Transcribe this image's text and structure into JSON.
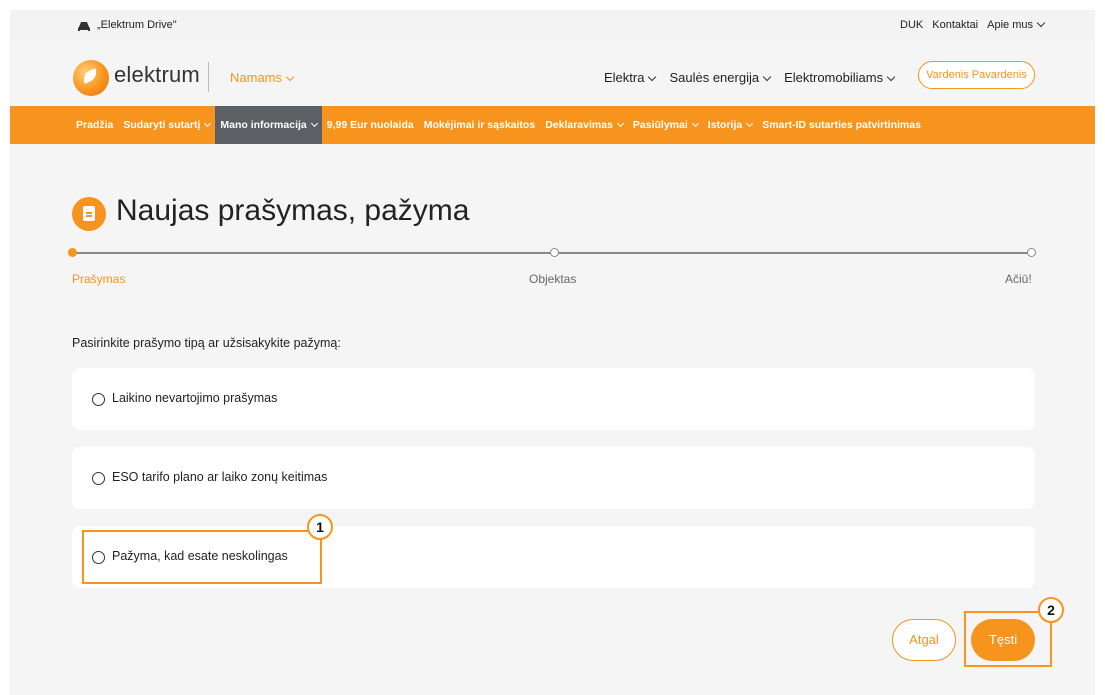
{
  "topbar": {
    "drive_label": "„Elektrum Drive\"",
    "links": [
      "DUK",
      "Kontaktai",
      "Apie mus"
    ]
  },
  "header": {
    "logo_text": "elektrum",
    "segment": "Namams",
    "nav": [
      "Elektra",
      "Saulės energija",
      "Elektromobiliams"
    ],
    "user_button": "Vardenis Pavardenis"
  },
  "orange_nav": {
    "items": [
      {
        "label": "Pradžia",
        "dropdown": false,
        "active": false
      },
      {
        "label": "Sudaryti sutartį",
        "dropdown": true,
        "active": false
      },
      {
        "label": "Mano informacija",
        "dropdown": true,
        "active": true
      },
      {
        "label": "9,99 Eur nuolaida",
        "dropdown": false,
        "active": false
      },
      {
        "label": "Mokėjimai ir sąskaitos",
        "dropdown": false,
        "active": false
      },
      {
        "label": "Deklaravimas",
        "dropdown": true,
        "active": false
      },
      {
        "label": "Pasiūlymai",
        "dropdown": true,
        "active": false
      },
      {
        "label": "Istorija",
        "dropdown": true,
        "active": false
      },
      {
        "label": "Smart-ID sutarties patvirtinimas",
        "dropdown": false,
        "active": false
      }
    ]
  },
  "page": {
    "title": "Naujas prašymas, pažyma",
    "steps": [
      "Prašymas",
      "Objektas",
      "Ačiū!"
    ],
    "current_step": 1,
    "question": "Pasirinkite prašymo tipą ar užsisakykite pažymą:",
    "options": [
      "Laikino nevartojimo prašymas",
      "ESO tarifo plano ar laiko zonų keitimas",
      "Pažyma, kad esate neskolingas"
    ],
    "back_button": "Atgal",
    "next_button": "Tęsti"
  },
  "annotations": [
    "1",
    "2"
  ],
  "colors": {
    "accent": "#f7941d",
    "active_nav": "#5c5f63",
    "background": "#f5f5f6"
  }
}
